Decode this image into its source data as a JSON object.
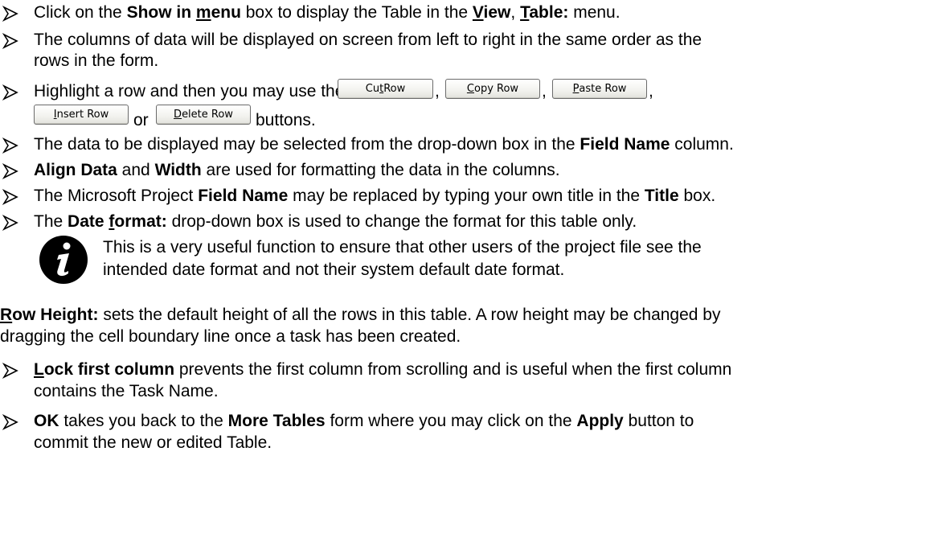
{
  "bullets": {
    "b1": {
      "t1": "Click on the ",
      "t2": "Show in ",
      "t3": "m",
      "t4": "enu",
      "t5": " box to display the Table in the ",
      "t6": "V",
      "t7": "iew",
      "t8": ", ",
      "t9": "T",
      "t10": "able:",
      "t11": " menu."
    },
    "b2": {
      "l1": "The columns of data will be displayed on screen from left to right in the same order as the",
      "l2": "rows in the form."
    },
    "b3": {
      "t1": "Highlight a row and then you may use the ",
      "sep1": ",",
      "sep2": ",",
      "sep3": ",",
      "or": "or",
      "end": "buttons."
    },
    "b4": {
      "t1": "The data to be displayed may be selected from the drop-down box in the ",
      "t2": "Field Name",
      "t3": " column."
    },
    "b5": {
      "t1": "Align Data",
      "t2": " and ",
      "t3": "Width",
      "t4": " are used for formatting the data in the columns."
    },
    "b6": {
      "t1": "The Microsoft Project ",
      "t2": "Field Name",
      "t3": " may be replaced by typing your own title in the ",
      "t4": "Title",
      "t5": " box."
    },
    "b7": {
      "t1": "The ",
      "t2": "Date ",
      "t3": "f",
      "t4": "ormat:",
      "t5": " drop-down box is used to change the format for this table only."
    },
    "b8": {
      "l1a": "Lock first column",
      "l1b": " prevents the first column from scrolling and is useful when the first column",
      "l2": "contains the Task Name."
    },
    "b9": {
      "t1": "OK",
      "t2": " takes you back to the ",
      "t3": "More Tables",
      "t4": " form where you may click on the ",
      "t5": "Apply",
      "t6": " button to",
      "l2": "commit the new or edited Table."
    }
  },
  "buttons": {
    "cut": {
      "a": "Cu",
      "u": "t",
      "b": " Row"
    },
    "copy": {
      "u": "C",
      "b": "opy Row"
    },
    "paste": {
      "u": "P",
      "b": "aste Row"
    },
    "insert": {
      "u": "I",
      "b": "nsert Row"
    },
    "delete": {
      "u": "D",
      "b": "elete Row"
    }
  },
  "note": {
    "icon": "info-icon",
    "l1": "This is a very useful function to ensure that other users of the project file see the",
    "l2": "intended date format and not their system default date format."
  },
  "row_height": {
    "u": "R",
    "b": "ow Height:",
    "l1": " sets the default height of all the rows in this table. A row height may be changed by",
    "l2": "dragging the cell boundary line once a task has been created."
  }
}
